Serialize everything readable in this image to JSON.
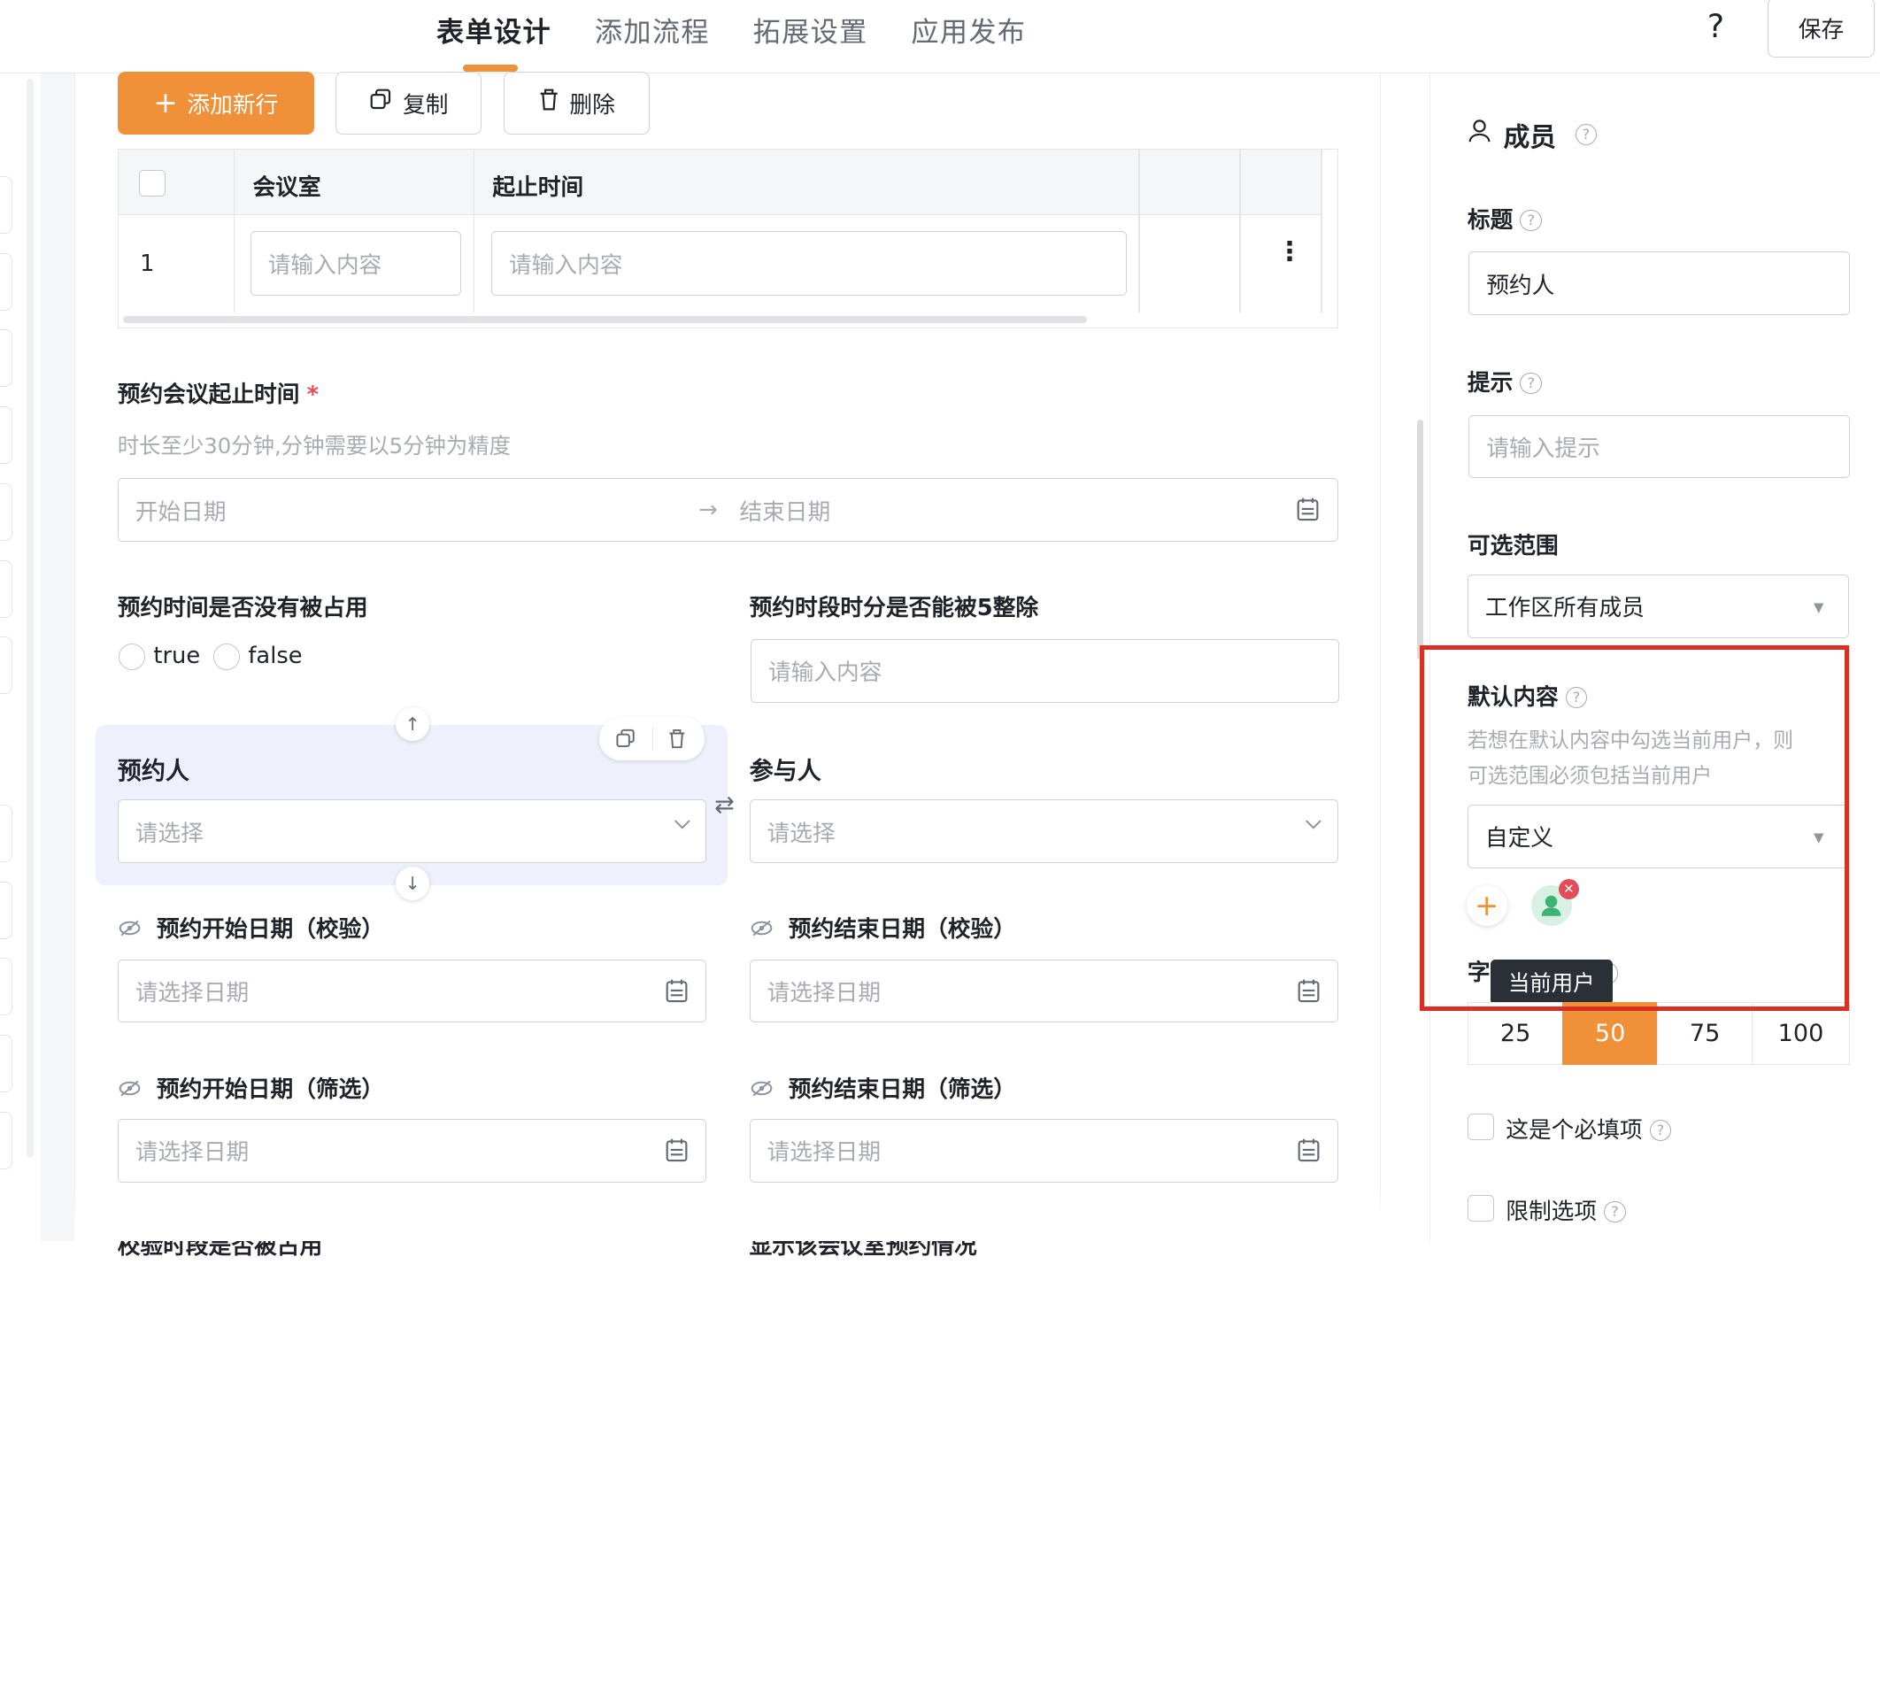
{
  "tabs": [
    {
      "label": "表单设计"
    },
    {
      "label": "添加流程"
    },
    {
      "label": "拓展设置"
    },
    {
      "label": "应用发布"
    }
  ],
  "help_label": "?",
  "save_label": "保存",
  "toolbar": {
    "add_row": "添加新行",
    "copy": "复制",
    "delete": "删除"
  },
  "table": {
    "headers": [
      "会议室",
      "起止时间"
    ],
    "rows": [
      {
        "index": "1",
        "room_placeholder": "请输入内容",
        "time_placeholder": "请输入内容"
      }
    ]
  },
  "fields": {
    "meeting_time": {
      "label": "预约会议起止时间",
      "required_mark": "*",
      "desc": "时长至少30分钟,分钟需要以5分钟为精度",
      "start_placeholder": "开始日期",
      "arrow": "→",
      "end_placeholder": "结束日期"
    },
    "not_occupied": {
      "label": "预约时间是否没有被占用",
      "options": [
        "true",
        "false"
      ]
    },
    "divisible5": {
      "label": "预约时段时分是否能被5整除",
      "placeholder": "请输入内容"
    },
    "booker": {
      "label": "预约人",
      "placeholder": "请选择"
    },
    "participants": {
      "label": "参与人",
      "placeholder": "请选择"
    },
    "start_date_check": {
      "label": "预约开始日期（校验）",
      "placeholder": "请选择日期"
    },
    "end_date_check": {
      "label": "预约结束日期（校验）",
      "placeholder": "请选择日期"
    },
    "start_date_filter": {
      "label": "预约开始日期（筛选）",
      "placeholder": "请选择日期"
    },
    "end_date_filter": {
      "label": "预约结束日期（筛选）",
      "placeholder": "请选择日期"
    },
    "cut_left": "校验时段是否被占用",
    "cut_right": "显示该会议室预约情况"
  },
  "panel": {
    "title": "成员",
    "title_label": "标题",
    "title_value": "预约人",
    "hint_label": "提示",
    "hint_placeholder": "请输入提示",
    "range_label": "可选范围",
    "range_value": "工作区所有成员",
    "default_label": "默认内容",
    "default_desc_1": "若想在默认内容中勾选当前用户，则",
    "default_desc_2": "可选范围必须包括当前用户",
    "default_value": "自定义",
    "tooltip": "当前用户",
    "width_label": "字段占比 %",
    "width_options": [
      "25",
      "50",
      "75",
      "100"
    ],
    "width_selected": "50",
    "required_label": "这是个必填项",
    "limit_label": "限制选项"
  },
  "colors": {
    "accent": "#f0913a",
    "highlight_box": "#d93025",
    "selected_card": "#eef1fb"
  }
}
